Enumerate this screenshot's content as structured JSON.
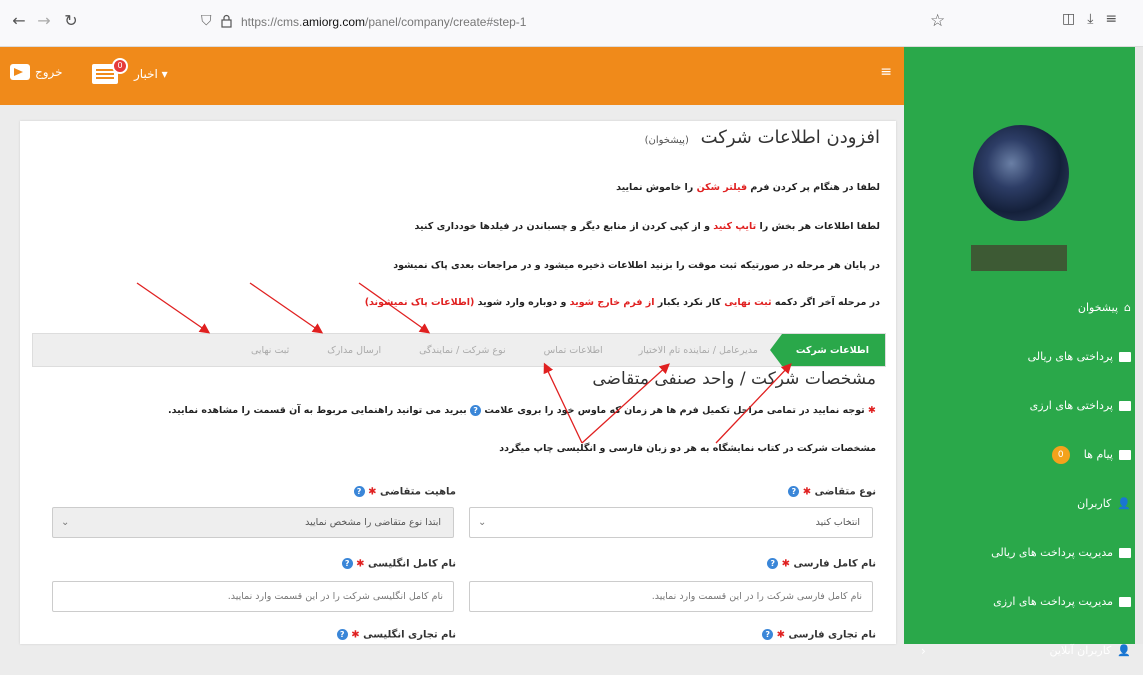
{
  "browser": {
    "url_prefix": "https://cms.",
    "url_domain": "amiorg.com",
    "url_path": "/panel/company/create#step-1",
    "back_icon": "arrow-left-icon",
    "forward_icon": "arrow-right-icon",
    "reload_icon": "reload-icon",
    "bookmark_icon": "star-icon"
  },
  "topbar": {
    "exit_label": "خروج",
    "news_label": "اخبار ▾",
    "news_badge": "0"
  },
  "sidebar": {
    "items": [
      {
        "label": "پیشخوان",
        "icon": "home-icon"
      },
      {
        "label": "پرداختی های ریالی",
        "icon": "card-icon"
      },
      {
        "label": "پرداختی های ارزی",
        "icon": "card-icon"
      },
      {
        "label": "پیام ها",
        "icon": "mail-icon",
        "badge": "0"
      },
      {
        "label": "کاربران",
        "icon": "user-icon"
      },
      {
        "label": "مدیریت پرداخت های ریالی",
        "icon": "card-icon"
      },
      {
        "label": "مدیریت پرداخت های ارزی",
        "icon": "card-icon"
      },
      {
        "label": "کاربران آنلاین",
        "icon": "user-icon"
      }
    ]
  },
  "page": {
    "title": "افزودن اطلاعات شرکت",
    "subtitle": "(پیشخوان)",
    "note1_a": "لطفا در هنگام پر کردن فرم ",
    "note1_red": "فیلتر شکن",
    "note1_b": " را خاموش نمایید",
    "note2_a": "لطفا اطلاعات هر بخش را ",
    "note2_red": "تایپ کنید",
    "note2_b": " و از کپی کردن از منابع دیگر و چسباندن در فیلدها خودداری کنید",
    "note3": "در پایان هر مرحله در صورتیکه ثبت موقت را بزنید اطلاعات ذخیره میشود و در مراجعات بعدی پاک نمیشود",
    "note4_a": "در مرحله آخر اگر دکمه ",
    "note4_red1": "ثبت نهایی",
    "note4_b": " کار نکرد یکبار ",
    "note4_red2": "از فرم خارج شوید",
    "note4_c": " و دوباره وارد شوید ",
    "note4_red3": "(اطلاعات پاک نمیشوند)"
  },
  "steps": [
    "اطلاعات شرکت",
    "مدیرعامل / نماینده تام الاختیار",
    "اطلاعات تماس",
    "نوع شرکت / نمایندگی",
    "ارسال مدارک",
    "ثبت نهایی"
  ],
  "section": {
    "title": "مشخصات شرکت / واحد صنفی متقاضی",
    "warn_a": "توجه نمایید در تمامی مراحل تکمیل فرم ها هر زمان که ماوس خود را بروی علامت ",
    "warn_b": " ببرید می توانید راهنمایی مربوط به آن قسمت را مشاهده نمایید.",
    "info": "مشخصات شرکت در کتاب نمایشگاه به هر دو زبان فارسی و انگلیسی چاپ میگردد"
  },
  "form": {
    "type_label": "نوع متقاضی",
    "type_value": "انتخاب کنید",
    "nature_label": "ماهیت متقاضی",
    "nature_value": "ابتدا نوع متقاضی را مشخص نمایید",
    "fa_name_label": "نام کامل فارسی",
    "fa_name_placeholder": "نام کامل فارسی شرکت را در این قسمت وارد نمایید.",
    "en_name_label": "نام کامل انگلیسی",
    "en_name_placeholder": "نام کامل انگلیسی شرکت را در این قسمت وارد نمایید.",
    "fa_trade_label": "نام تجاری فارسی",
    "en_trade_label": "نام تجاری انگلیسی",
    "help_glyph": "?",
    "req_glyph": "✱"
  }
}
